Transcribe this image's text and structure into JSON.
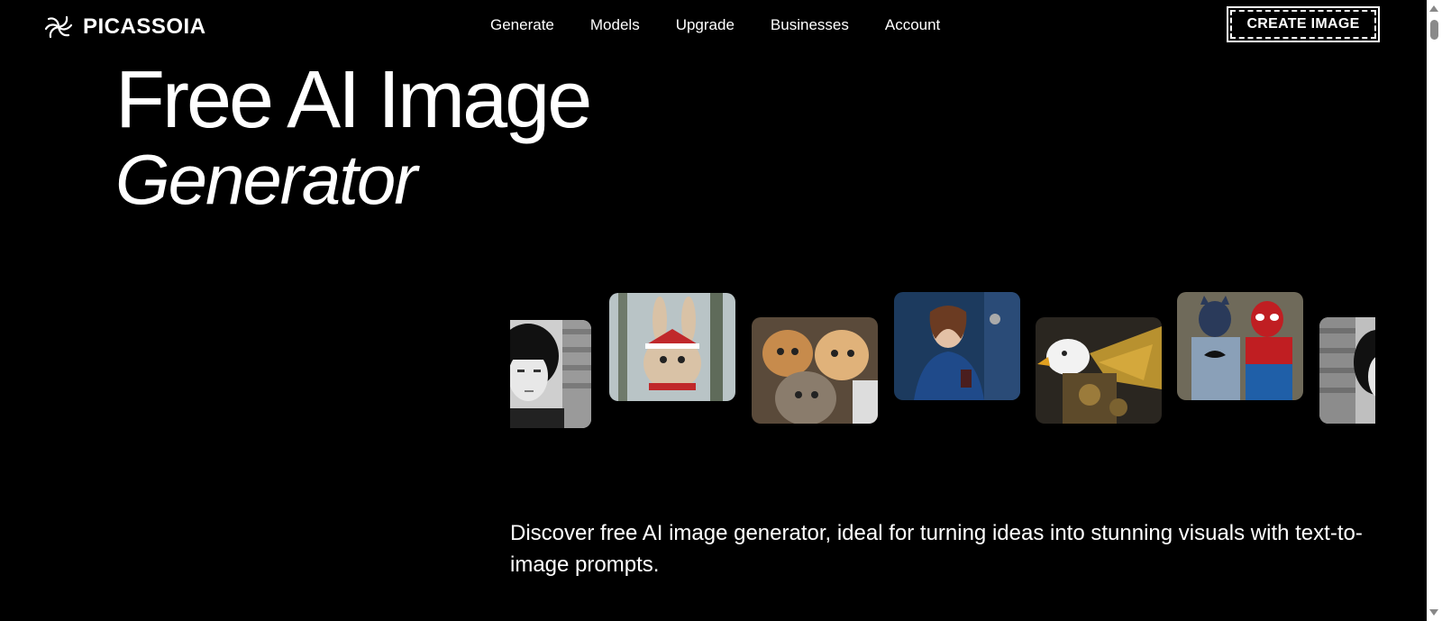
{
  "brand": {
    "name": "PICASSOIA",
    "logo_icon": "swirl-icon"
  },
  "nav": {
    "items": [
      {
        "label": "Generate"
      },
      {
        "label": "Models"
      },
      {
        "label": "Upgrade"
      },
      {
        "label": "Businesses"
      },
      {
        "label": "Account"
      }
    ]
  },
  "header": {
    "cta_label": "CREATE IMAGE"
  },
  "hero": {
    "title_line1": "Free AI Image",
    "title_line2": "Generator",
    "description": "Discover free AI image generator, ideal for turning ideas into stunning visuals with text-to-image prompts."
  },
  "carousel": {
    "images": [
      "portrait-girl-bob-hair-image",
      "rabbit-santa-hat-image",
      "cats-selfie-image",
      "woman-blue-dress-image",
      "mechanical-eagle-image",
      "batman-spiderman-image",
      "portrait-girl-bob-hair-image"
    ]
  },
  "colors": {
    "background": "#000000",
    "text": "#ffffff",
    "scrollbar": "#ffffff"
  }
}
